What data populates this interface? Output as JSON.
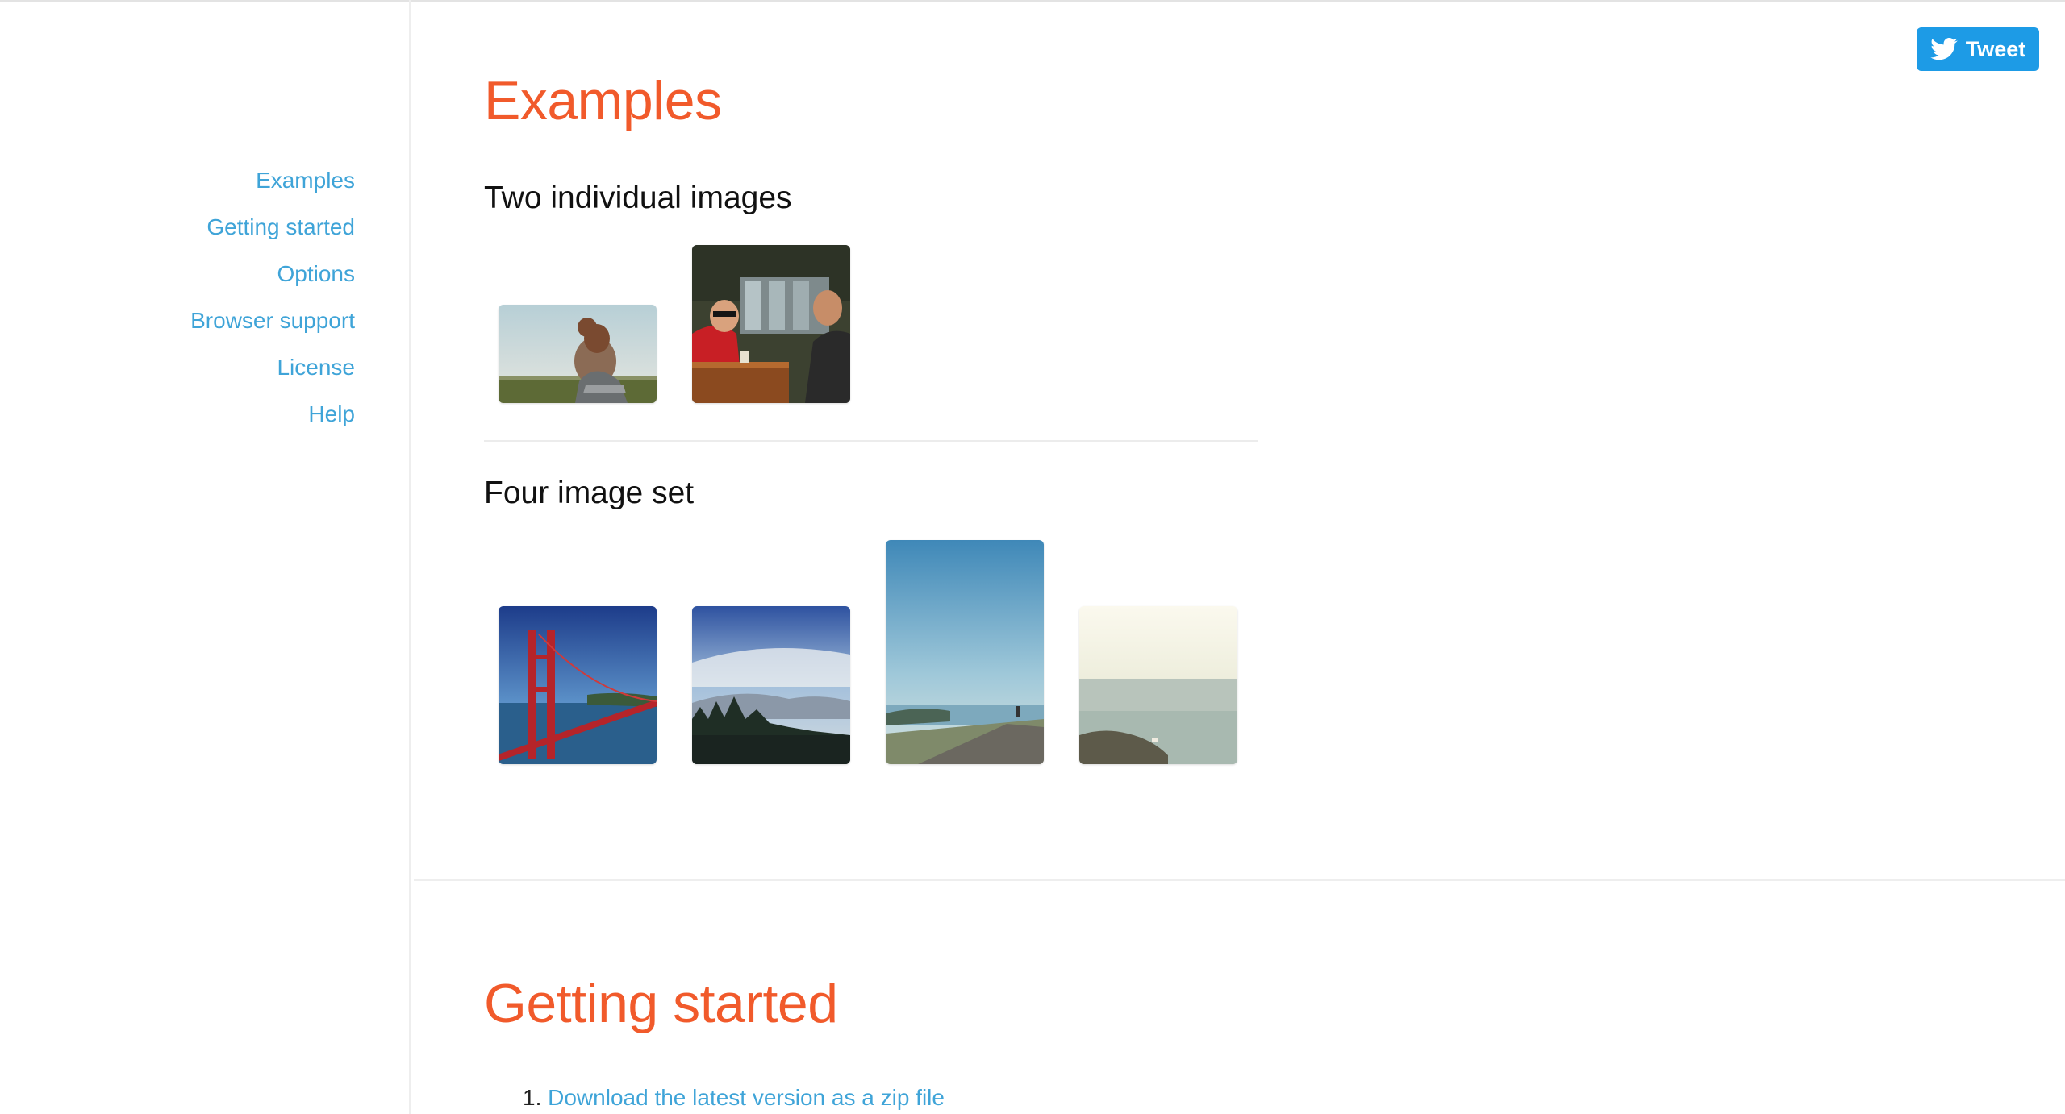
{
  "sidebar": {
    "items": [
      {
        "label": "Examples"
      },
      {
        "label": "Getting started"
      },
      {
        "label": "Options"
      },
      {
        "label": "Browser support"
      },
      {
        "label": "License"
      },
      {
        "label": "Help"
      }
    ]
  },
  "tweet": {
    "label": "Tweet",
    "icon": "twitter-bird-icon"
  },
  "examples": {
    "title": "Examples",
    "two_images_title": "Two individual images",
    "four_images_title": "Four image set"
  },
  "getting_started": {
    "title": "Getting started",
    "step_number": "1.",
    "step_link": "Download the latest version as a zip file"
  },
  "colors": {
    "accent": "#f15a2b",
    "link": "#3fa4d8",
    "tweet_button": "#1d9be6"
  }
}
